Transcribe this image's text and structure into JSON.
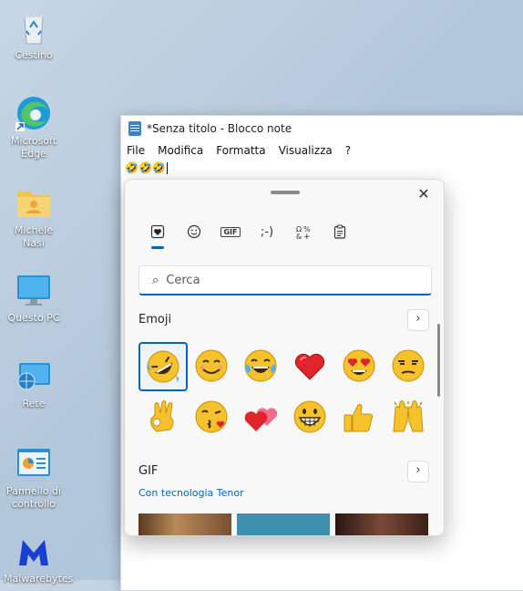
{
  "desktop": {
    "icons": [
      {
        "label": "Cestino",
        "icon": "recycle-bin-icon"
      },
      {
        "label": "Microsoft Edge",
        "icon": "edge-icon"
      },
      {
        "label": "Michele Nasi",
        "icon": "user-folder-icon"
      },
      {
        "label": "Questo PC",
        "icon": "monitor-icon"
      },
      {
        "label": "Rete",
        "icon": "network-icon"
      },
      {
        "label": "Pannello di controllo",
        "icon": "control-panel-icon"
      },
      {
        "label": "Malwarebytes",
        "icon": "malwarebytes-icon"
      }
    ]
  },
  "notepad": {
    "title": "*Senza titolo - Blocco note",
    "menu": [
      "File",
      "Modifica",
      "Formatta",
      "Visualizza",
      "?"
    ],
    "content": "🤣🤣🤣"
  },
  "emoji_panel": {
    "close_glyph": "✕",
    "tabs": [
      {
        "name": "emoji-tab",
        "glyph": "♥",
        "active": true
      },
      {
        "name": "smiley-tab",
        "glyph": "☺"
      },
      {
        "name": "gif-tab",
        "glyph": "GIF"
      },
      {
        "name": "kaomoji-tab",
        "glyph": ";-)"
      },
      {
        "name": "symbols-tab",
        "glyph": "Ω"
      },
      {
        "name": "clipboard-tab",
        "glyph": "📋"
      }
    ],
    "search_placeholder": "Cerca",
    "emoji_section_title": "Emoji",
    "gif_section_title": "GIF",
    "gif_powered_by": "Con tecnologia Tenor",
    "emojis": [
      {
        "char": "🤣",
        "name": "rolling-on-floor-laughing"
      },
      {
        "char": "😊",
        "name": "smiling-face"
      },
      {
        "char": "😂",
        "name": "tears-of-joy"
      },
      {
        "char": "❤️",
        "name": "red-heart"
      },
      {
        "char": "😍",
        "name": "heart-eyes"
      },
      {
        "char": "😒",
        "name": "unamused-face"
      },
      {
        "char": "👌",
        "name": "ok-hand"
      },
      {
        "char": "😘",
        "name": "face-blowing-kiss"
      },
      {
        "char": "💕",
        "name": "two-hearts"
      },
      {
        "char": "😁",
        "name": "beaming-face"
      },
      {
        "char": "👍",
        "name": "thumbs-up"
      },
      {
        "char": "🙌",
        "name": "raising-hands"
      }
    ],
    "selected_emoji_index": 0,
    "colors": {
      "accent": "#0067c0",
      "emoji_yellow": "#f6c22c",
      "heart_red": "#e0242b"
    }
  }
}
